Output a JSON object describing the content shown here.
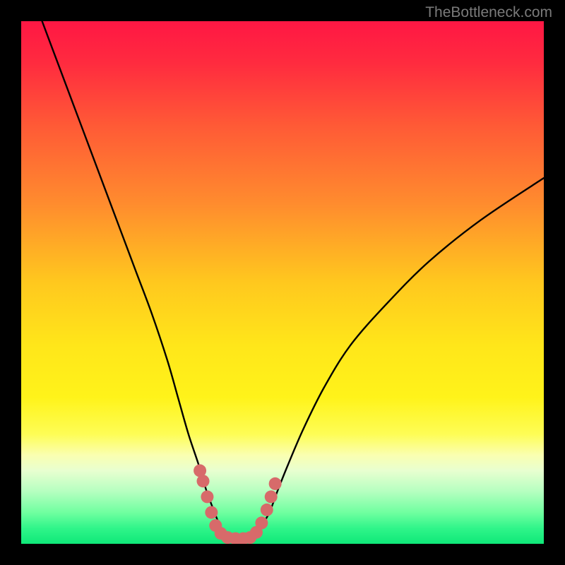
{
  "watermark": "TheBottleneck.com",
  "chart_data": {
    "type": "line",
    "title": "",
    "xlabel": "",
    "ylabel": "",
    "xlim": [
      0,
      100
    ],
    "ylim": [
      0,
      100
    ],
    "grid": false,
    "legend": false,
    "annotations": [],
    "gradient_stops": [
      {
        "offset": 0.0,
        "color": "#ff1744"
      },
      {
        "offset": 0.08,
        "color": "#ff2b3f"
      },
      {
        "offset": 0.2,
        "color": "#ff5a36"
      },
      {
        "offset": 0.35,
        "color": "#ff8c2e"
      },
      {
        "offset": 0.5,
        "color": "#ffc81e"
      },
      {
        "offset": 0.62,
        "color": "#ffe61a"
      },
      {
        "offset": 0.72,
        "color": "#fff31a"
      },
      {
        "offset": 0.79,
        "color": "#fefd55"
      },
      {
        "offset": 0.83,
        "color": "#faffb0"
      },
      {
        "offset": 0.86,
        "color": "#e8ffd0"
      },
      {
        "offset": 0.9,
        "color": "#b5ffc0"
      },
      {
        "offset": 0.94,
        "color": "#70ffa0"
      },
      {
        "offset": 0.97,
        "color": "#30f58a"
      },
      {
        "offset": 1.0,
        "color": "#0fe878"
      }
    ],
    "series": [
      {
        "name": "bottleneck-curve",
        "color": "#000000",
        "x": [
          4,
          7,
          10,
          13,
          16,
          19,
          22,
          25,
          28,
          30,
          32,
          34,
          35.5,
          37,
          38,
          39,
          40,
          44,
          45,
          46,
          47.5,
          49,
          51,
          54,
          58,
          63,
          70,
          78,
          88,
          100
        ],
        "y": [
          100,
          92,
          84,
          76,
          68,
          60,
          52,
          44,
          35,
          28,
          21,
          15,
          10,
          6,
          3.5,
          2,
          1.2,
          1.2,
          2,
          3.5,
          6,
          10,
          15,
          22,
          30,
          38,
          46,
          54,
          62,
          70
        ]
      }
    ],
    "markers": {
      "name": "highlight-dots",
      "color": "#d76a6a",
      "points": [
        {
          "x": 34.2,
          "y": 14
        },
        {
          "x": 34.8,
          "y": 12
        },
        {
          "x": 35.6,
          "y": 9
        },
        {
          "x": 36.4,
          "y": 6
        },
        {
          "x": 37.2,
          "y": 3.5
        },
        {
          "x": 38.2,
          "y": 2
        },
        {
          "x": 39.5,
          "y": 1.2
        },
        {
          "x": 41.0,
          "y": 1.0
        },
        {
          "x": 42.5,
          "y": 1.0
        },
        {
          "x": 43.8,
          "y": 1.2
        },
        {
          "x": 45.0,
          "y": 2.2
        },
        {
          "x": 46.0,
          "y": 4
        },
        {
          "x": 47.0,
          "y": 6.5
        },
        {
          "x": 47.8,
          "y": 9
        },
        {
          "x": 48.6,
          "y": 11.5
        }
      ]
    }
  }
}
